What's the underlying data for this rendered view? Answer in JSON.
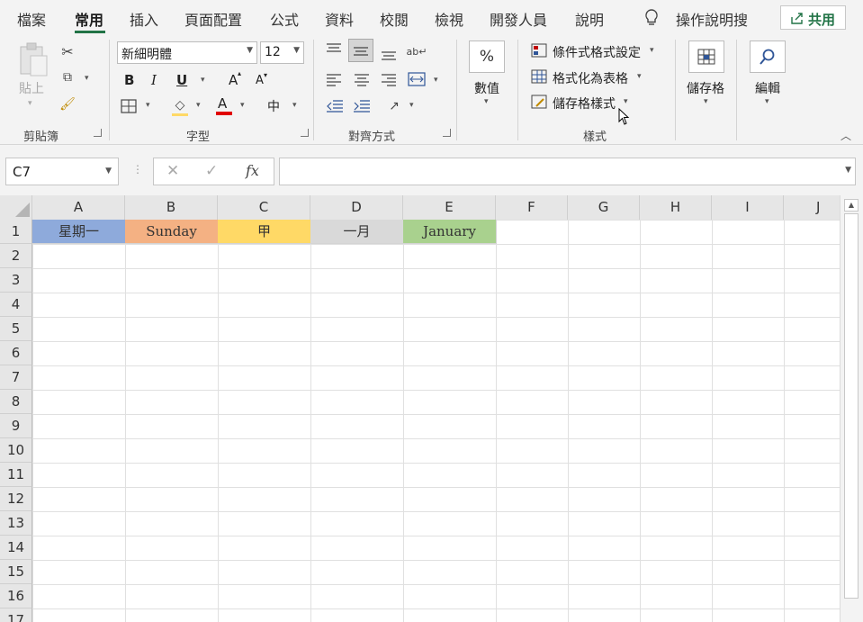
{
  "menu": {
    "tabs": [
      "檔案",
      "常用",
      "插入",
      "頁面配置",
      "公式",
      "資料",
      "校閱",
      "檢視",
      "開發人員",
      "說明"
    ],
    "tell_me": "操作說明搜",
    "share": "共用"
  },
  "ribbon": {
    "clipboard": {
      "paste": "貼上",
      "label": "剪貼簿"
    },
    "font": {
      "name": "新細明體",
      "size": "12",
      "bold": "B",
      "italic": "I",
      "underline": "U",
      "increase": "A",
      "decrease": "A",
      "color_letter": "A",
      "phonetic": "中",
      "label": "字型"
    },
    "alignment": {
      "label": "對齊方式"
    },
    "number": {
      "symbol": "%",
      "label": "數值"
    },
    "styles": {
      "conditional": "條件式格式設定",
      "format_table": "格式化為表格",
      "cell_styles": "儲存格樣式",
      "label": "樣式"
    },
    "cells": {
      "label": "儲存格"
    },
    "editing": {
      "label": "編輯"
    }
  },
  "formula_bar": {
    "name_box": "C7",
    "fx": "fx",
    "formula": ""
  },
  "grid": {
    "columns": [
      "A",
      "B",
      "C",
      "D",
      "E",
      "F",
      "G",
      "H",
      "I",
      "J"
    ],
    "rows": [
      "1",
      "2",
      "3",
      "4",
      "5",
      "6",
      "7",
      "8",
      "9",
      "10",
      "11",
      "12",
      "13",
      "14",
      "15",
      "16",
      "17"
    ],
    "row1": [
      "星期一",
      "Sunday",
      "甲",
      "一月",
      "January"
    ],
    "row1_colors": [
      "#8eaadb",
      "#f4b183",
      "#ffd966",
      "#d9d9d9",
      "#a9d18e"
    ]
  },
  "colors": {
    "accent": "#217346"
  }
}
